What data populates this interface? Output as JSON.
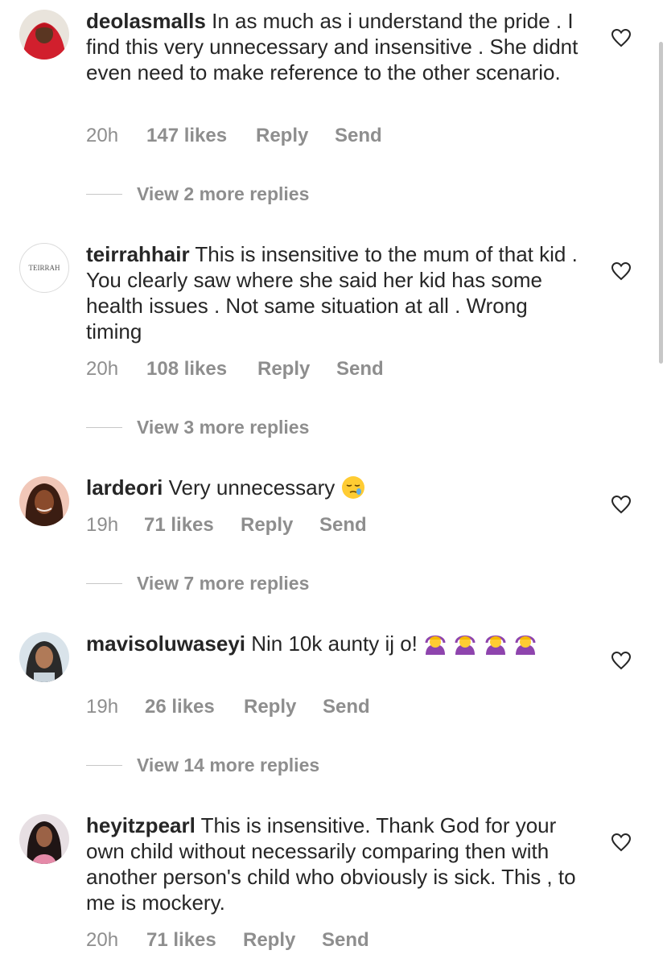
{
  "comments": [
    {
      "username": "deolasmalls",
      "text": "In as much as i understand the pride . I find this very unnecessary and insensitive . She didnt even need to make reference to the other scenario.",
      "time": "20h",
      "likes": "147 likes",
      "reply": "Reply",
      "send": "Send",
      "view_replies": "View 2 more replies"
    },
    {
      "username": "teirrahhair",
      "avatar_text": "TEIRRAH",
      "text": "This is insensitive to the mum of that kid . You clearly saw where she said her kid has some health issues . Not same situation at all . Wrong timing",
      "time": "20h",
      "likes": "108 likes",
      "reply": "Reply",
      "send": "Send",
      "view_replies": "View 3 more replies"
    },
    {
      "username": "lardeori",
      "text": "Very unnecessary",
      "emoji": "sleepy-face",
      "time": "19h",
      "likes": "71 likes",
      "reply": "Reply",
      "send": "Send",
      "view_replies": "View 7 more replies"
    },
    {
      "username": "mavisoluwaseyi",
      "text": "Nin 10k aunty ij o!",
      "emoji": "woman-gesturing-ok",
      "time": "19h",
      "likes": "26 likes",
      "reply": "Reply",
      "send": "Send",
      "view_replies": "View 14 more replies"
    },
    {
      "username": "heyitzpearl",
      "text": "This is insensitive. Thank God for your own child without necessarily comparing then with another person's child who obviously is sick. This , to me is mockery.",
      "time": "20h",
      "likes": "71 likes",
      "reply": "Reply",
      "send": "Send"
    }
  ],
  "colors": {
    "text": "#262626",
    "secondary": "#8e8e8e",
    "divider": "#c7c7c7"
  }
}
